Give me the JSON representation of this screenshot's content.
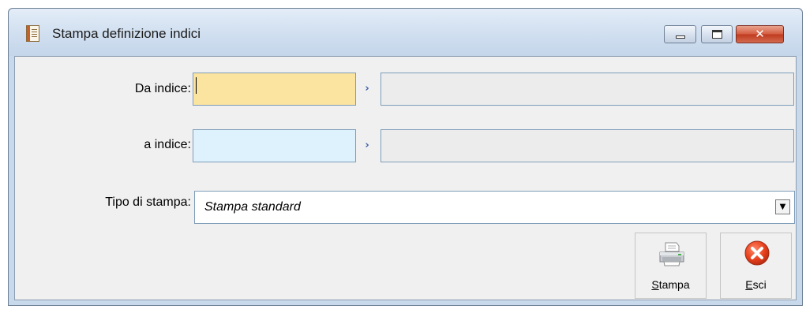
{
  "window": {
    "title": "Stampa definizione indici",
    "icon": "document-list-icon",
    "controls": [
      "minimize-icon",
      "maximize-icon",
      "close-icon"
    ],
    "close_glyph": "✕"
  },
  "form": {
    "da_indice": {
      "label": "Da indice:",
      "code_value": "",
      "description_value": ""
    },
    "a_indice": {
      "label": "a indice:",
      "code_value": "",
      "description_value": ""
    },
    "zoom_glyph": "›",
    "tipo_stampa": {
      "label": "Tipo di stampa:",
      "selected": "Stampa standard",
      "arrow_glyph": "▼"
    }
  },
  "buttons": {
    "stampa": {
      "accel": "S",
      "rest": "tampa",
      "icon": "printer-icon"
    },
    "esci": {
      "accel": "E",
      "rest": "sci",
      "icon": "exit-icon"
    }
  },
  "colors": {
    "focused_field": "#fbe3a0",
    "code_field": "#ddf2fc",
    "description_field": "#ececec",
    "exit_icon": "#e8401c"
  }
}
